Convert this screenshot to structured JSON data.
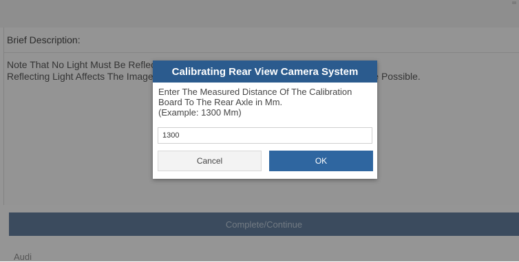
{
  "page": {
    "brief_label": "Brief Description:",
    "description_lines": [
      "Note That No Light Must Be Reflecting On The Calibration Board.",
      "Reflecting Light Affects The Image Quality Of The Camera, And Calibration May Not Be Possible."
    ],
    "complete_button": "Complete/Continue",
    "brand": "Audi"
  },
  "dialog": {
    "title": "Calibrating Rear View Camera System",
    "message_lines": [
      "Enter The Measured Distance Of The Calibration",
      "Board To The Rear Axle in Mm.",
      "(Example: 1300 Mm)"
    ],
    "input_value": "1300",
    "cancel_label": "Cancel",
    "ok_label": "OK"
  },
  "colors": {
    "dialog_title_bg": "#2b5b8e",
    "ok_button_bg": "#2f66a0",
    "complete_button_bg": "#5f7a98"
  }
}
